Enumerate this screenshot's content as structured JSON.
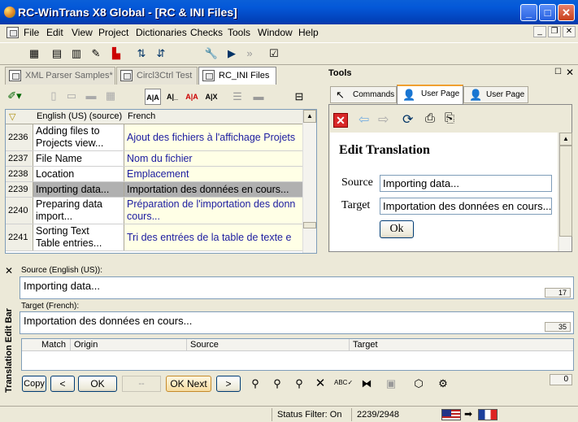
{
  "window": {
    "title": "RC-WinTrans X8 Global - [RC & INI Files]"
  },
  "menu": [
    "File",
    "Edit",
    "View",
    "Project",
    "Dictionaries",
    "Checks",
    "Tools",
    "Window",
    "Help"
  ],
  "doc_tabs": [
    {
      "label": "XML Parser Samples*"
    },
    {
      "label": "Circl3Ctrl Test"
    },
    {
      "label": "RC_INI Files"
    }
  ],
  "grid": {
    "col_source": "English (US) (source)",
    "col_target": "French",
    "rows": [
      {
        "id": "2236",
        "source": "Adding files to\nProjects view...",
        "target": "Ajout des fichiers à l'affichage Projets"
      },
      {
        "id": "2237",
        "source": "File Name",
        "target": "Nom du fichier"
      },
      {
        "id": "2238",
        "source": "Location",
        "target": "Emplacement"
      },
      {
        "id": "2239",
        "source": "Importing data...",
        "target": "Importation des données en cours..."
      },
      {
        "id": "2240",
        "source": "Preparing data\nimport...",
        "target": "Préparation de l'importation des donn\ncours..."
      },
      {
        "id": "2241",
        "source": "Sorting Text\nTable entries...",
        "target": "Tri des entrées de la table de texte e"
      }
    ]
  },
  "tools_panel": {
    "title": "Tools",
    "tabs": [
      "Commands",
      "User Page I",
      "User Page II"
    ],
    "heading": "Edit Translation",
    "source_label": "Source",
    "source_value": "Importing data...",
    "target_label": "Target",
    "target_value": "Importation des données en cours...",
    "ok_label": "Ok"
  },
  "edit_bar": {
    "side_title": "Translation Edit Bar",
    "source_label": "Source (English (US)):",
    "source_text": "Importing data...",
    "source_count": "17",
    "target_label": "Target (French):",
    "target_text": "Importation des données en cours...",
    "target_count": "35",
    "match_headers": {
      "match": "Match",
      "origin": "Origin",
      "source": "Source",
      "target": "Target"
    },
    "buttons": {
      "copy": "Copy",
      "prev": "<",
      "ok": "OK",
      "dash": "--",
      "ok_next": "OK Next",
      "next": ">"
    },
    "counter": "0"
  },
  "status": {
    "filter": "Status Filter: On",
    "position": "2239/2948"
  }
}
